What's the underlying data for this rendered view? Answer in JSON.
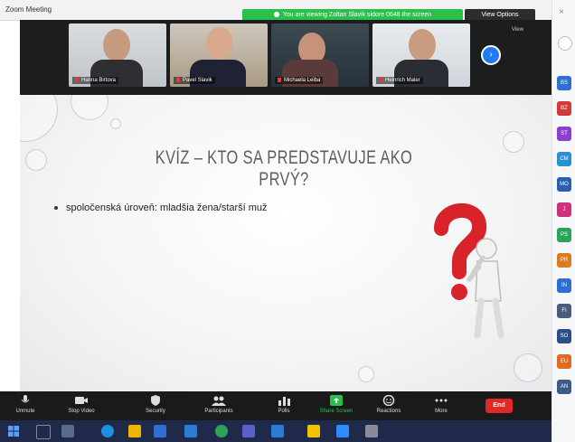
{
  "window": {
    "title": "Zoom Meeting"
  },
  "share_banner": {
    "text": "You are viewing Zoltan Slavik sidore 0648 the screen"
  },
  "view_options": {
    "label": "View Options"
  },
  "video_strip": {
    "view_label": "View",
    "participants": [
      {
        "name": "Hanna Birtova"
      },
      {
        "name": "Pavel Slavik"
      },
      {
        "name": "Michaela Leiba"
      },
      {
        "name": "Heinrich Maler"
      }
    ]
  },
  "slide": {
    "title": "KVÍZ – KTO SA PREDSTAVUJE AKO PRVÝ?",
    "bullet": "spoločenská úroveň: mladšia žena/starší muž"
  },
  "toolbar": {
    "items": [
      {
        "label": "Unmute",
        "icon": "microphone-icon"
      },
      {
        "label": "Stop Video",
        "icon": "video-camera-icon"
      },
      {
        "label": "Security",
        "icon": "shield-icon"
      },
      {
        "label": "Participants",
        "icon": "participants-icon"
      },
      {
        "label": "Polls",
        "icon": "polls-icon"
      },
      {
        "label": "Share Screen",
        "icon": "share-screen-icon"
      },
      {
        "label": "Reactions",
        "icon": "smiley-icon"
      },
      {
        "label": "More",
        "icon": "more-icon"
      }
    ],
    "end_label": "End",
    "share_color": "#2bbf4b",
    "end_color": "#e02828"
  },
  "right_panel": {
    "icons": [
      {
        "label": "BS",
        "color": "#2f6fd1"
      },
      {
        "label": "BZ",
        "color": "#d13b3b"
      },
      {
        "label": "ST",
        "color": "#8b3fcf"
      },
      {
        "label": "CM",
        "color": "#2b8fd6"
      },
      {
        "label": "MO",
        "color": "#2c5fb0"
      },
      {
        "label": "J",
        "color": "#cf2f7b"
      },
      {
        "label": "PS",
        "color": "#2ba35a"
      },
      {
        "label": "PR",
        "color": "#e07a1f"
      },
      {
        "label": "IN",
        "color": "#2c6fd1"
      },
      {
        "label": "FI",
        "color": "#4a5c7a"
      },
      {
        "label": "SO",
        "color": "#2a4f8a"
      },
      {
        "label": "EU",
        "color": "#e06a1f"
      },
      {
        "label": "AN",
        "color": "#3d5a8a"
      }
    ]
  }
}
